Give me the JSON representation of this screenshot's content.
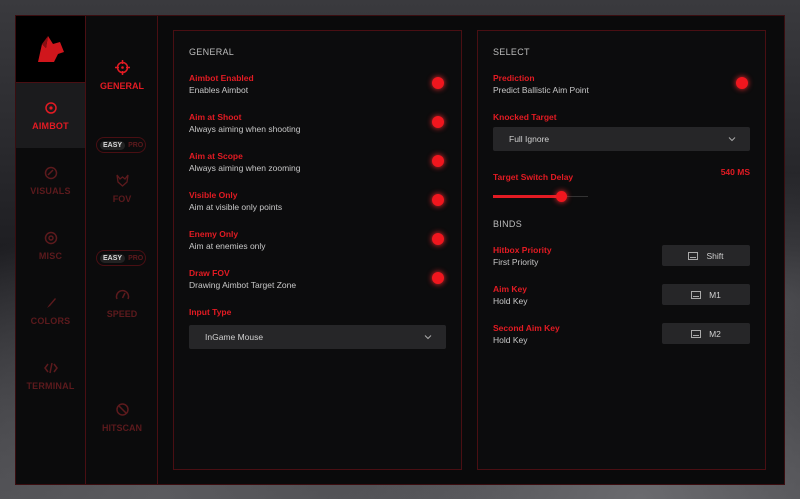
{
  "sidebar": {
    "items": [
      {
        "label": "AIMBOT",
        "icon": "crosshair-icon",
        "active": true
      },
      {
        "label": "VISUALS",
        "icon": "eye-icon",
        "active": false
      },
      {
        "label": "MISC",
        "icon": "gear-icon",
        "active": false
      },
      {
        "label": "COLORS",
        "icon": "brush-icon",
        "active": false
      },
      {
        "label": "TERMINAL",
        "icon": "code-icon",
        "active": false
      }
    ]
  },
  "subnav": {
    "general_label": "GENERAL",
    "fov_label": "FOV",
    "speed_label": "SPEED",
    "hitscan_label": "HITSCAN",
    "mode_easy": "EASY",
    "mode_pro": "PRO"
  },
  "general": {
    "title": "GENERAL",
    "options": [
      {
        "title": "Aimbot Enabled",
        "desc": "Enables Aimbot",
        "enabled": true
      },
      {
        "title": "Aim at Shoot",
        "desc": "Always aiming when shooting",
        "enabled": true
      },
      {
        "title": "Aim at Scope",
        "desc": "Always aiming when zooming",
        "enabled": true
      },
      {
        "title": "Visible Only",
        "desc": "Aim at visible only points",
        "enabled": true
      },
      {
        "title": "Enemy Only",
        "desc": "Aim at enemies only",
        "enabled": true
      },
      {
        "title": "Draw FOV",
        "desc": "Drawing Aimbot Target Zone",
        "enabled": true
      }
    ],
    "input_type_label": "Input Type",
    "input_type_value": "InGame Mouse"
  },
  "select": {
    "title": "SELECT",
    "prediction_title": "Prediction",
    "prediction_desc": "Predict Ballistic Aim Point",
    "knocked_label": "Knocked Target",
    "knocked_value": "Full Ignore",
    "delay_label": "Target Switch Delay",
    "delay_value": "540 MS",
    "delay_fraction": 0.72,
    "binds_title": "BINDS",
    "binds": [
      {
        "title": "Hitbox Priority",
        "desc": "First Priority",
        "key": "Shift"
      },
      {
        "title": "Aim Key",
        "desc": "Hold Key",
        "key": "M1"
      },
      {
        "title": "Second Aim Key",
        "desc": "Hold Key",
        "key": "M2"
      }
    ]
  },
  "colors": {
    "accent": "#e31b23"
  }
}
